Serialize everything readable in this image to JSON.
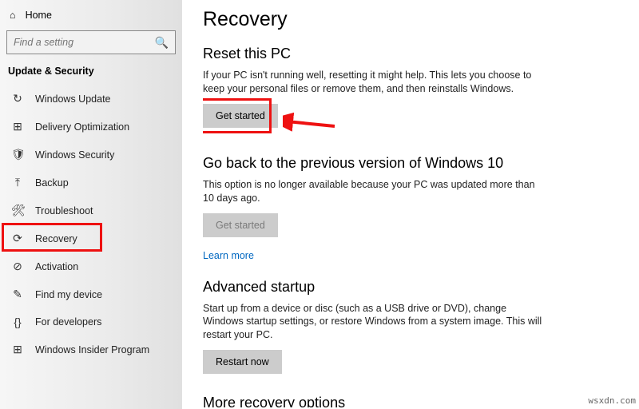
{
  "sidebar": {
    "home": "Home",
    "search_placeholder": "Find a setting",
    "group": "Update & Security",
    "items": [
      {
        "icon": "sync",
        "label": "Windows Update"
      },
      {
        "icon": "delivery",
        "label": "Delivery Optimization"
      },
      {
        "icon": "shield",
        "label": "Windows Security"
      },
      {
        "icon": "backup",
        "label": "Backup"
      },
      {
        "icon": "wrench",
        "label": "Troubleshoot"
      },
      {
        "icon": "recovery",
        "label": "Recovery"
      },
      {
        "icon": "key",
        "label": "Activation"
      },
      {
        "icon": "find",
        "label": "Find my device"
      },
      {
        "icon": "dev",
        "label": "For developers"
      },
      {
        "icon": "insider",
        "label": "Windows Insider Program"
      }
    ]
  },
  "page": {
    "title": "Recovery",
    "reset": {
      "heading": "Reset this PC",
      "body": "If your PC isn't running well, resetting it might help. This lets you choose to keep your personal files or remove them, and then reinstalls Windows.",
      "button": "Get started"
    },
    "goback": {
      "heading": "Go back to the previous version of Windows 10",
      "body": "This option is no longer available because your PC was updated more than 10 days ago.",
      "button": "Get started",
      "link": "Learn more"
    },
    "advanced": {
      "heading": "Advanced startup",
      "body": "Start up from a device or disc (such as a USB drive or DVD), change Windows startup settings, or restore Windows from a system image. This will restart your PC.",
      "button": "Restart now"
    },
    "more": {
      "heading": "More recovery options"
    }
  },
  "watermark": "wsxdn.com",
  "icons": {
    "home": "⌂",
    "search": "🔍",
    "sync": "↻",
    "delivery": "⊞",
    "shield": "🛡",
    "backup": "⤒",
    "wrench": "🛠",
    "recovery": "⟳",
    "key": "⊘",
    "find": "✎",
    "dev": "{}",
    "insider": "⊞"
  }
}
